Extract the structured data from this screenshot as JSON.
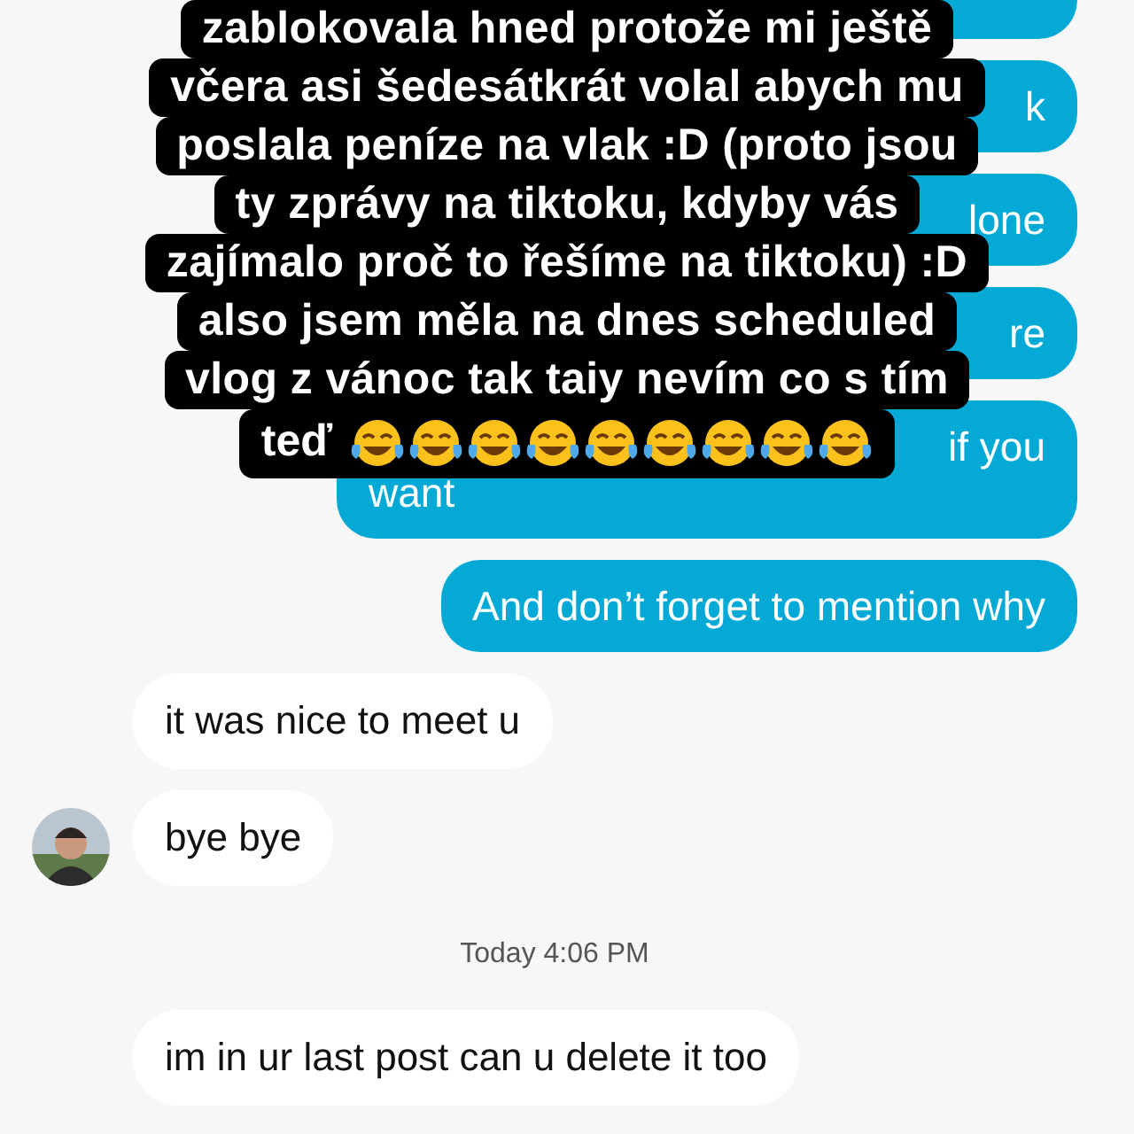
{
  "messages": [
    {
      "kind": "out"
    },
    {
      "kind": "out",
      "lines": [
        "k"
      ]
    },
    {
      "kind": "out",
      "lines": [
        "lone"
      ]
    },
    {
      "kind": "out",
      "lines": [
        "re"
      ]
    },
    {
      "kind": "out",
      "lines": [
        "if you",
        "want"
      ]
    },
    {
      "kind": "out",
      "lines": [
        "And don’t forget to mention why"
      ]
    },
    {
      "kind": "in",
      "lines": [
        "it was nice to meet u"
      ],
      "avatar": false
    },
    {
      "kind": "in",
      "lines": [
        "bye bye"
      ],
      "avatar": true
    },
    {
      "kind": "time",
      "lines": [
        "Today 4:06 PM"
      ]
    },
    {
      "kind": "in",
      "lines": [
        "im in ur last post can u delete it too"
      ],
      "avatar": false
    }
  ],
  "caption": {
    "lines": [
      "zablokovala hned protože mi ještě",
      "včera asi šedesátkrát volal abych mu",
      "poslala peníze na vlak :D (proto jsou",
      "ty zprávy na tiktoku, kdyby vás",
      "zajímalo proč to řešíme na tiktoku) :D",
      "also jsem měla na dnes scheduled",
      "vlog z vánoc tak taiy nevím co s tím"
    ],
    "last_line": "teď",
    "emojis": [
      {
        "kind": "tears-of-joy"
      },
      {
        "kind": "tears-of-joy"
      },
      {
        "kind": "tears-of-joy"
      },
      {
        "kind": "tears-of-joy"
      },
      {
        "kind": "tears-of-joy"
      },
      {
        "kind": "tears-of-joy"
      },
      {
        "kind": "tears-of-joy"
      },
      {
        "kind": "tears-of-joy"
      },
      {
        "kind": "tears-of-joy"
      }
    ]
  }
}
